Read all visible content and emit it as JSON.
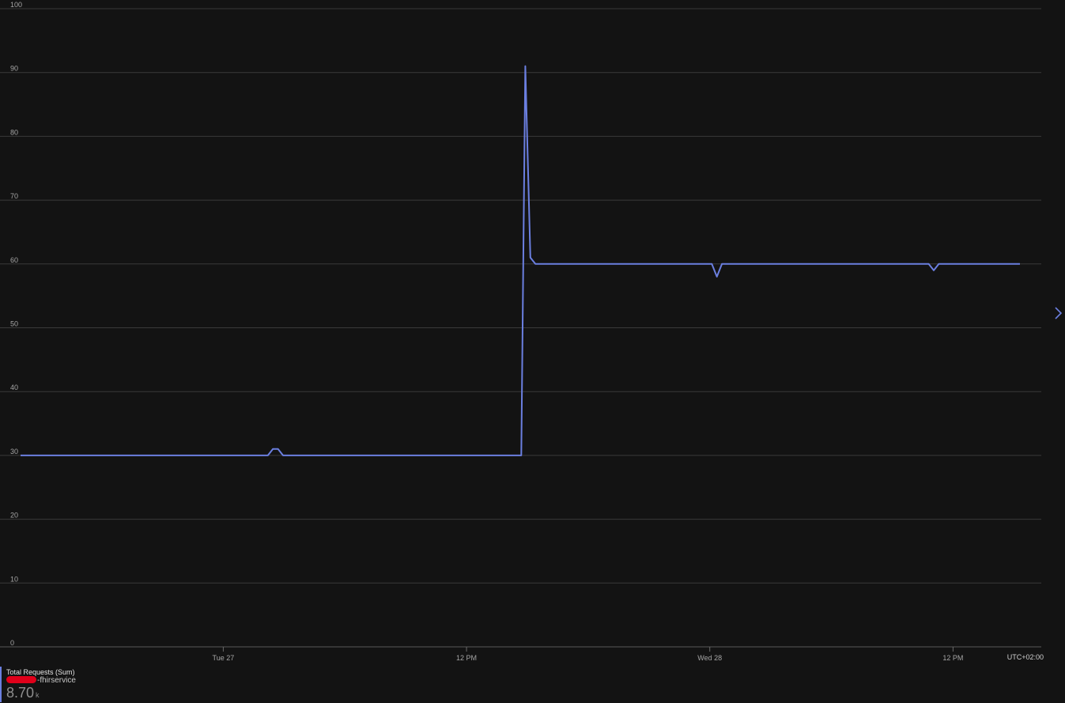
{
  "chart_data": {
    "type": "line",
    "y_ticks": [
      "100",
      "90",
      "80",
      "70",
      "60",
      "50",
      "40",
      "30",
      "20",
      "10",
      "0"
    ],
    "ylim": [
      0,
      100
    ],
    "grid": true,
    "x_ticks": [
      {
        "label": "Tue 27",
        "hours": 10
      },
      {
        "label": "12 PM",
        "hours": 22
      },
      {
        "label": "Wed 28",
        "hours": 34
      },
      {
        "label": "12 PM",
        "hours": 46
      }
    ],
    "x_range_hours": [
      0,
      49.3
    ],
    "timezone": "UTC+02:00",
    "series": [
      {
        "name": "Total Requests (Sum)",
        "color": "#6b7fe0",
        "points": [
          [
            0,
            30
          ],
          [
            12.2,
            30
          ],
          [
            12.45,
            31
          ],
          [
            12.7,
            31
          ],
          [
            12.95,
            30
          ],
          [
            24.7,
            30
          ],
          [
            24.9,
            91
          ],
          [
            25.15,
            61
          ],
          [
            25.4,
            60
          ],
          [
            34.1,
            60
          ],
          [
            34.35,
            58
          ],
          [
            34.6,
            60
          ],
          [
            44.8,
            60
          ],
          [
            45.05,
            59
          ],
          [
            45.3,
            60
          ],
          [
            49.3,
            60
          ]
        ]
      }
    ]
  },
  "legend": {
    "series_label": "Total Requests (Sum)",
    "resource_suffix": "-fhirservice",
    "value": "8.70",
    "unit": "k"
  },
  "colors": {
    "background": "#131313",
    "grid": "#3a3a3a",
    "series": "#6b7fe0"
  }
}
